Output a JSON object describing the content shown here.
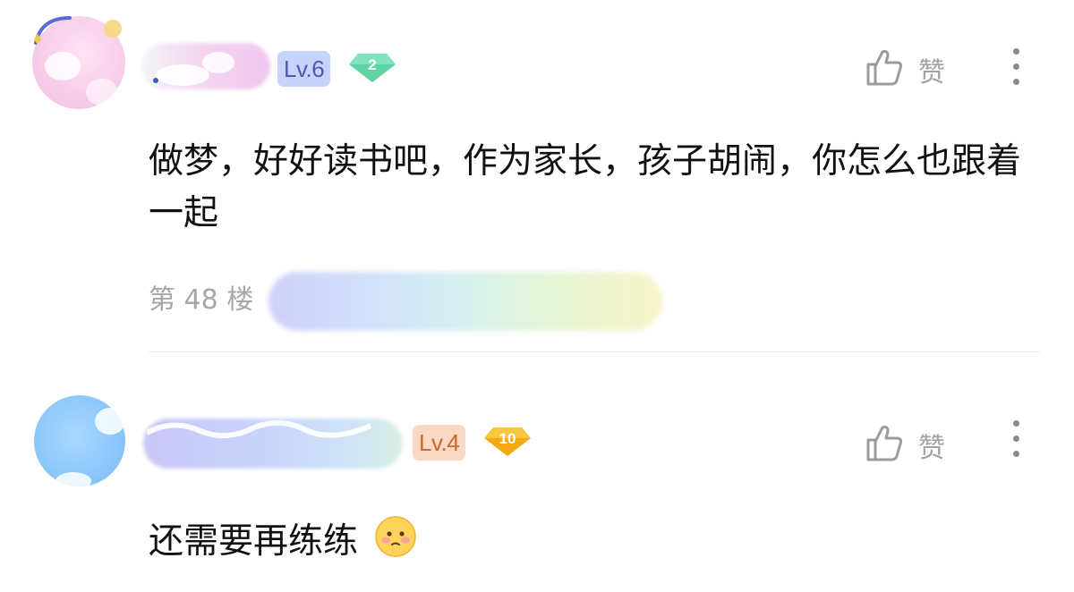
{
  "comments": [
    {
      "level": "Lv.6",
      "gem_count": "2",
      "gem_color": "#5fd3a4",
      "like_label": "赞",
      "text": "做梦，好好读书吧，作为家长，孩子胡闹，你怎么也跟着一起",
      "floor": "第 48 楼"
    },
    {
      "level": "Lv.4",
      "gem_count": "10",
      "gem_color": "#f7b71b",
      "like_label": "赞",
      "text": "还需要再练练",
      "emoji": "blushing-face-emoji"
    }
  ],
  "colors": {
    "lv6_badge_bg": "#c8d3fb",
    "lv4_badge_bg": "#fad9c4",
    "secondary_text": "#a3a3a3"
  },
  "icons": [
    "thumbs-up-icon",
    "more-vertical-icon"
  ]
}
